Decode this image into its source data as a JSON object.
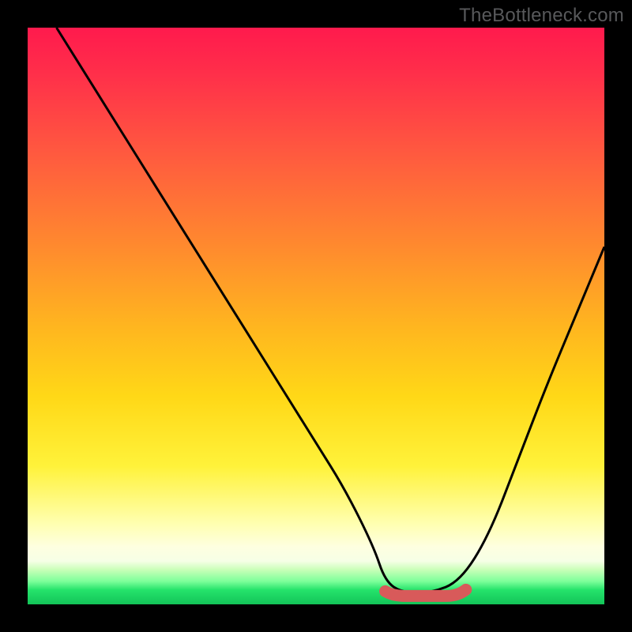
{
  "watermark": "TheBottleneck.com",
  "colors": {
    "background": "#000000",
    "watermark_text": "#58595b",
    "curve": "#000000",
    "bottom_band": "#d85a5a",
    "gradient_top": "#ff1a4d",
    "gradient_bottom": "#13c458"
  },
  "chart_data": {
    "type": "line",
    "title": "",
    "xlabel": "",
    "ylabel": "",
    "xlim": [
      0,
      100
    ],
    "ylim": [
      0,
      100
    ],
    "grid": false,
    "legend": false,
    "series": [
      {
        "name": "bottleneck-curve",
        "x": [
          5,
          10,
          15,
          20,
          25,
          30,
          35,
          40,
          45,
          50,
          55,
          60,
          62,
          65,
          70,
          75,
          80,
          85,
          90,
          95,
          100
        ],
        "y": [
          100,
          92,
          84,
          76,
          68,
          60,
          52,
          44,
          36,
          28,
          20,
          10,
          4,
          2,
          2,
          4,
          12,
          25,
          38,
          50,
          62
        ]
      }
    ],
    "annotations": [
      {
        "name": "flat-minimum-band",
        "x_range": [
          62,
          76
        ],
        "y": 2,
        "color": "#d85a5a"
      }
    ]
  }
}
